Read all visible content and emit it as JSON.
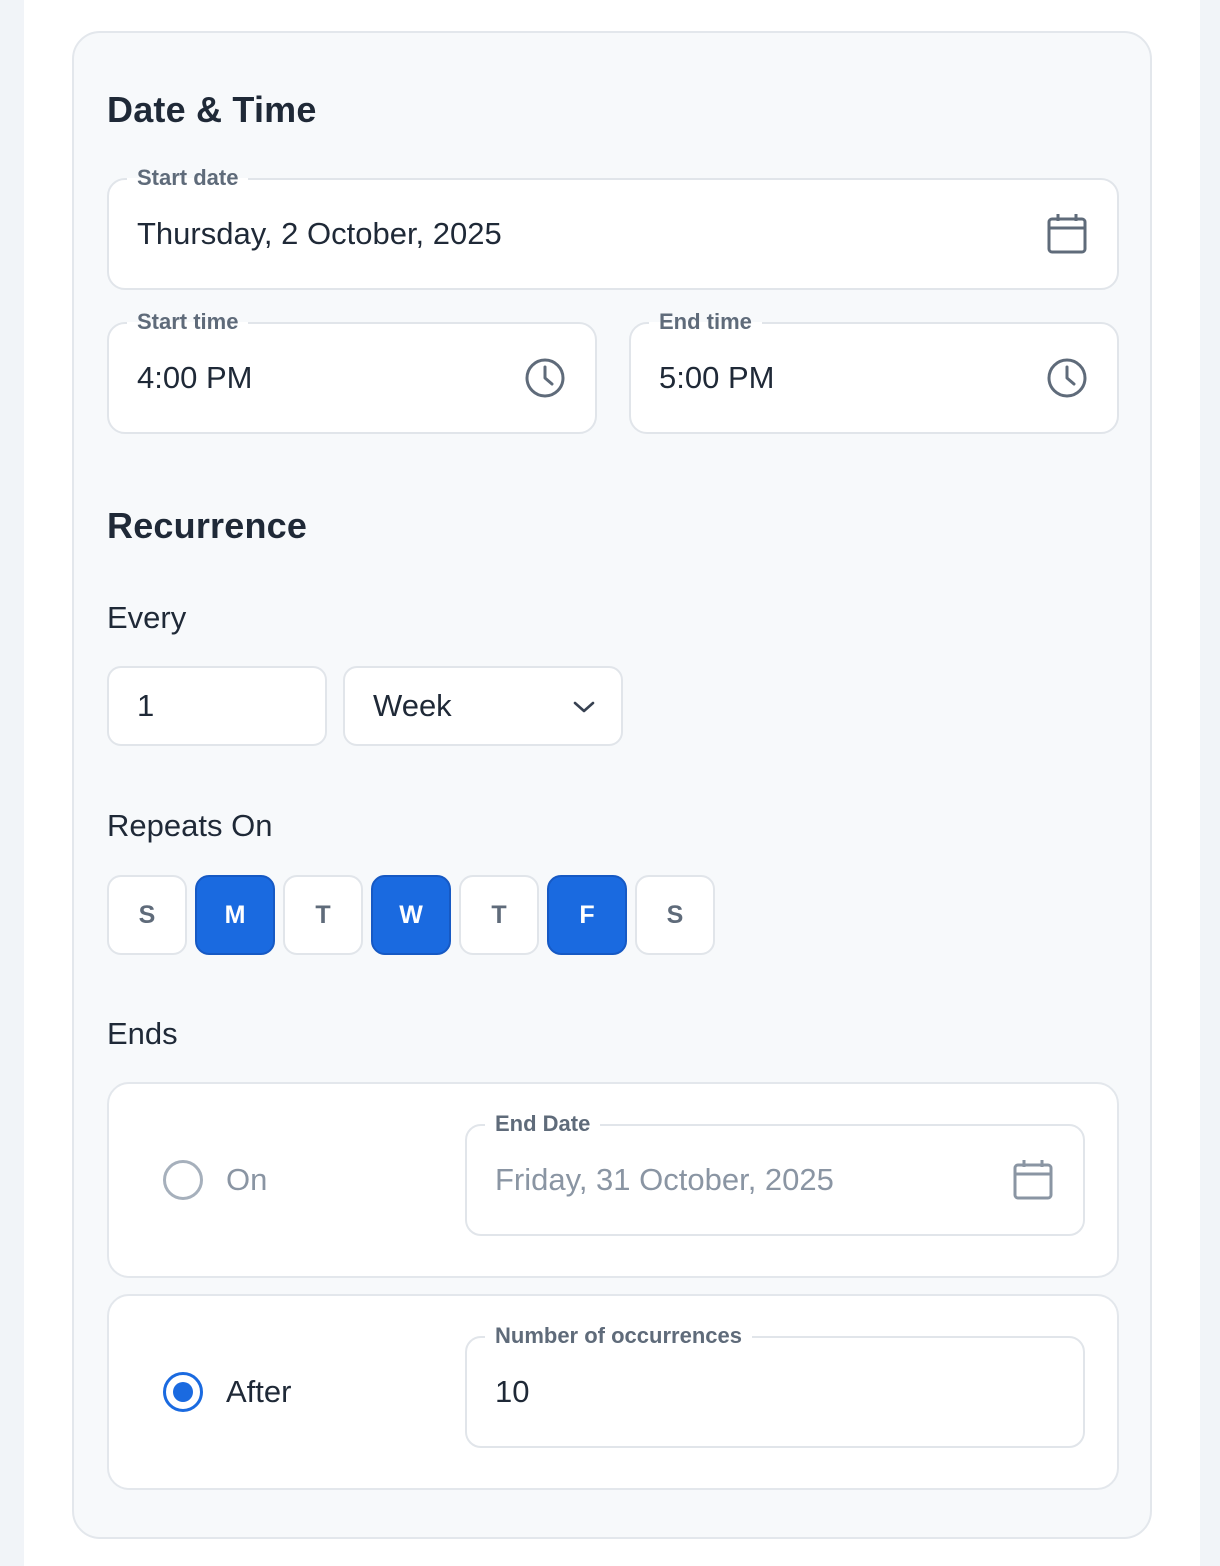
{
  "date_time": {
    "title": "Date & Time",
    "start_date": {
      "label": "Start date",
      "value": "Thursday, 2 October, 2025",
      "icon": "calendar-icon"
    },
    "start_time": {
      "label": "Start time",
      "value": "4:00 PM",
      "icon": "clock-icon"
    },
    "end_time": {
      "label": "End time",
      "value": "5:00 PM",
      "icon": "clock-icon"
    }
  },
  "recurrence": {
    "title": "Recurrence",
    "every_label": "Every",
    "interval_value": "1",
    "unit_value": "Week",
    "repeats_on_label": "Repeats On",
    "days": [
      {
        "label": "S",
        "selected": false
      },
      {
        "label": "M",
        "selected": true
      },
      {
        "label": "T",
        "selected": false
      },
      {
        "label": "W",
        "selected": true
      },
      {
        "label": "T",
        "selected": false
      },
      {
        "label": "F",
        "selected": true
      },
      {
        "label": "S",
        "selected": false
      }
    ],
    "ends_label": "Ends",
    "ends_on": {
      "radio_label": "On",
      "selected": false,
      "field_label": "End Date",
      "field_value": "Friday, 31 October, 2025",
      "icon": "calendar-icon"
    },
    "ends_after": {
      "radio_label": "After",
      "selected": true,
      "field_label": "Number of occurrences",
      "field_value": "10"
    }
  },
  "colors": {
    "accent": "#1a6ae0",
    "card_bg": "#f7f9fb",
    "text": "#1f2937",
    "muted": "#5f6b7a"
  }
}
